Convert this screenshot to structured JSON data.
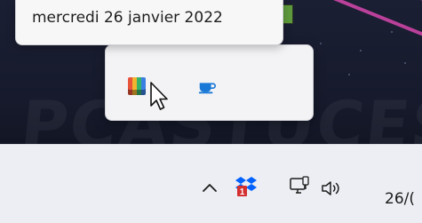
{
  "tooltip": {
    "date_text": "mercredi 26 janvier 2022"
  },
  "overflow_panel": {
    "apps": [
      {
        "name": "color-app",
        "icon": "palette-grid-icon"
      },
      {
        "name": "caffeine-app",
        "icon": "coffee-cup-icon"
      }
    ]
  },
  "taskbar": {
    "tray_icons": [
      {
        "icon": "chevron-up-icon"
      },
      {
        "icon": "dropbox-icon",
        "badge": "1"
      },
      {
        "icon": "network-icon"
      },
      {
        "icon": "speaker-icon"
      }
    ],
    "clock_partial": "26/("
  },
  "colors": {
    "taskbar_bg": "#eceef3",
    "wallpaper_bg": "#1b1f33",
    "accent_pink": "#d436a8",
    "dropbox_blue": "#0061fe",
    "badge_red": "#d32f2f"
  }
}
